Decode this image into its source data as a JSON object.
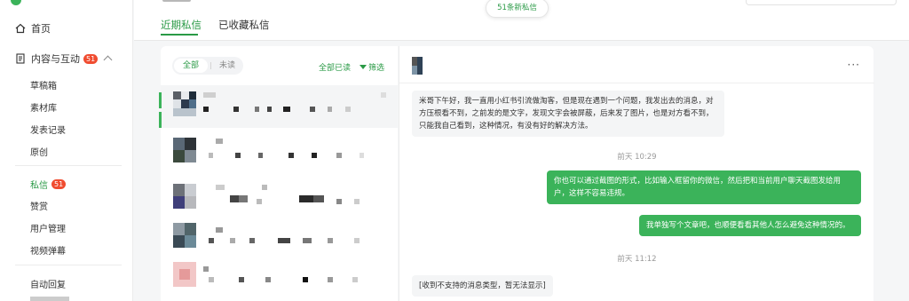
{
  "sidebar": {
    "home_label": "首页",
    "content_label": "内容与互动",
    "content_badge": "51",
    "items": [
      {
        "label": "草稿箱"
      },
      {
        "label": "素材库"
      },
      {
        "label": "发表记录"
      },
      {
        "label": "原创"
      }
    ],
    "dm_label": "私信",
    "dm_badge": "51",
    "items2": [
      {
        "label": "赞赏"
      },
      {
        "label": "用户管理"
      },
      {
        "label": "视频弹幕"
      }
    ],
    "auto_reply_label": "自动回复"
  },
  "tabs": [
    {
      "label": "近期私信",
      "active": true
    },
    {
      "label": "已收藏私信",
      "active": false
    }
  ],
  "new_message_pill": "51条新私信",
  "list": {
    "segment_all": "全部",
    "segment_unread": "未读",
    "mark_all_read": "全部已读",
    "filter": "筛选"
  },
  "chat": {
    "more_icon": "more-icon",
    "messages": [
      {
        "direction": "in",
        "text": "米哥下午好，我一直用小红书引流做淘客，但是现在遇到一个问题，我发出去的消息，对方压根看不到，之前发的是文字，发现文字会被屏蔽，后来发了图片，也是对方看不到，只能我自己看到，这种情况，有没有好的解决方法。"
      },
      {
        "type": "time",
        "text": "前天 10:29"
      },
      {
        "direction": "out",
        "text": "你也可以通过截图的形式，比如输入框留你的微信，然后把和当前用户聊天截图发给用户，这样不容易违规。"
      },
      {
        "direction": "out",
        "text": "我单独写个文章吧，也顺便看看其他人怎么避免这种情况的。"
      },
      {
        "type": "time",
        "text": "前天 11:12"
      },
      {
        "direction": "in",
        "text": "[收到不支持的消息类型，暂无法显示]"
      }
    ]
  },
  "colors": {
    "accent": "#2a9a46",
    "bubble_out": "#3bb35a",
    "badge": "#f04c30"
  }
}
